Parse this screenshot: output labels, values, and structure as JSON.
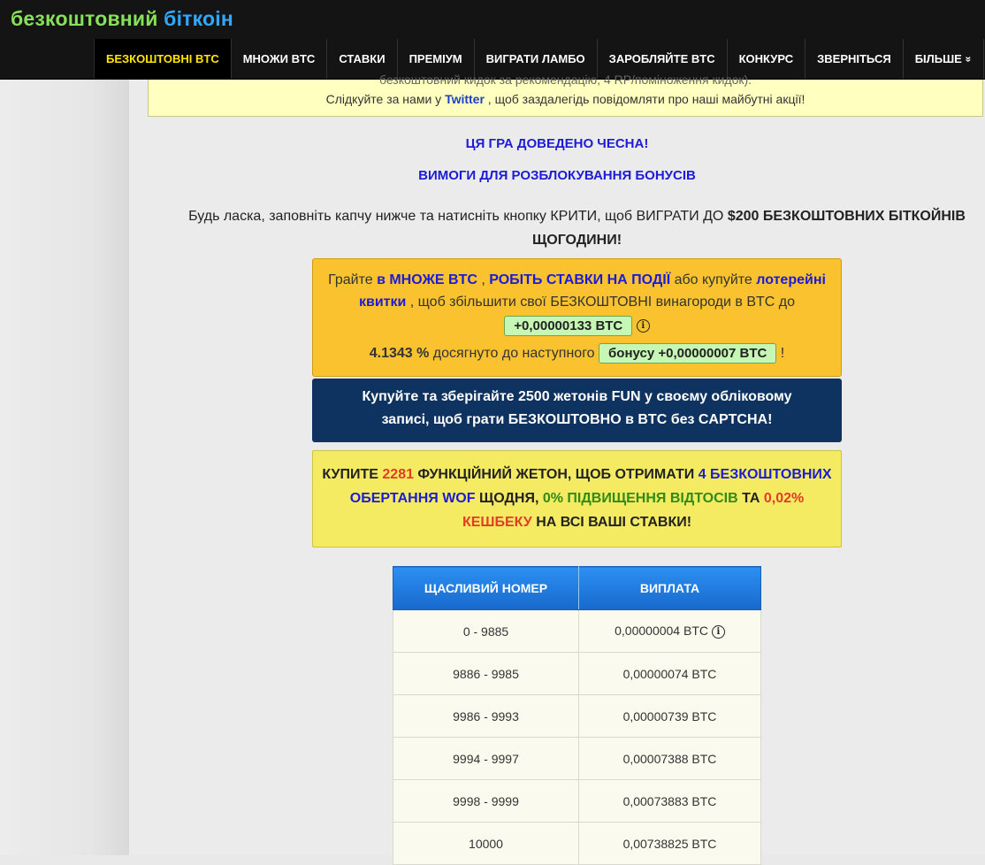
{
  "logo": {
    "part1": "безкоштовний ",
    "part2": "біткоін"
  },
  "nav": {
    "items": [
      {
        "label": "БЕЗКОШТОВНІ BTC",
        "active": true
      },
      {
        "label": "МНОЖИ BTC"
      },
      {
        "label": "СТАВКИ"
      },
      {
        "label": "ПРЕМІУМ"
      },
      {
        "label": "ВИГРАТИ ЛАМБО"
      },
      {
        "label": "ЗАРОБЛЯЙТЕ BTC"
      },
      {
        "label": "КОНКУРС"
      },
      {
        "label": "ЗВЕРНІТЬСЯ"
      },
      {
        "label": "БІЛЬШЕ"
      }
    ],
    "more_chevron": "»"
  },
  "notice": {
    "cut_line": "безкоштовний кидок за рекомендацію, 4 RP/поміноження кидок).",
    "line2_pre": "Слідкуйте за нами у ",
    "line2_link": "Twitter",
    "line2_post": " , щоб заздалегідь повідомляти про наші майбутні акції!"
  },
  "links": {
    "provably_fair": "ЦЯ ГРА ДОВЕДЕНО ЧЕСНА!",
    "bonus_requirements": "ВИМОГИ ДЛЯ РОЗБЛОКУВАННЯ БОНУСІВ"
  },
  "intro": {
    "pre": "Будь ласка, заповніть капчу нижче та натисніть кнопку КРИТИ, щоб ВИГРАТИ ДО ",
    "bold": "$200 БЕЗКОШТОВНИХ БІТКОЙНІВ ЩОГОДИНИ!"
  },
  "orange_box": {
    "t1": "Грайте ",
    "l1": "в МНОЖЕ BTC",
    "t2": " , ",
    "l2": "РОБІТЬ СТАВКИ НА ПОДІЇ",
    "t3": " або купуйте ",
    "l3": "лотерейні квитки",
    "t4": " , щоб збільшити свої БЕЗКОШТОВНІ винагороди в BTC до",
    "reward_pill": "+0,00000133 BTC",
    "percent": "4.1343 %",
    "t5": " досягнуто до наступного",
    "bonus_pill": "бонусу +0,00000007 BTC",
    "t6": " !"
  },
  "navy_box": {
    "text": "Купуйте та зберігайте 2500 жетонів FUN у своєму обліковому записі, щоб грати БЕЗКОШТОВНО в BTC без CAPTCHA!"
  },
  "yellow_box": {
    "a": "КУПИТЕ ",
    "n1": "2281",
    "b": " ФУНКЦІЙНИЙ ЖЕТОН, ЩОБ ОТРИМАТИ ",
    "n2": "4 БЕЗКОШТОВНИХ ОБЕРТАННЯ WOF",
    "c": " ЩОДНЯ, ",
    "g": "0% ПІДВИЩЕННЯ ВІДТОСІВ",
    "d": " ТА ",
    "r": "0,02% КЕШБЕКУ",
    "e": " НА ВСІ ВАШІ СТАВКИ!"
  },
  "payout_table": {
    "headers": [
      "ЩАСЛИВИЙ НОМЕР",
      "ВИПЛАТА"
    ],
    "rows": [
      {
        "range": "0 - 9885",
        "payout": "0,00000004 BTC"
      },
      {
        "range": "9886 - 9985",
        "payout": "0,00000074 BTC"
      },
      {
        "range": "9986 - 9993",
        "payout": "0,00000739 BTC"
      },
      {
        "range": "9994 - 9997",
        "payout": "0,00007388 BTC"
      },
      {
        "range": "9998 - 9999",
        "payout": "0,00073883 BTC"
      },
      {
        "range": "10000",
        "payout": "0,00738825 BTC"
      }
    ]
  }
}
